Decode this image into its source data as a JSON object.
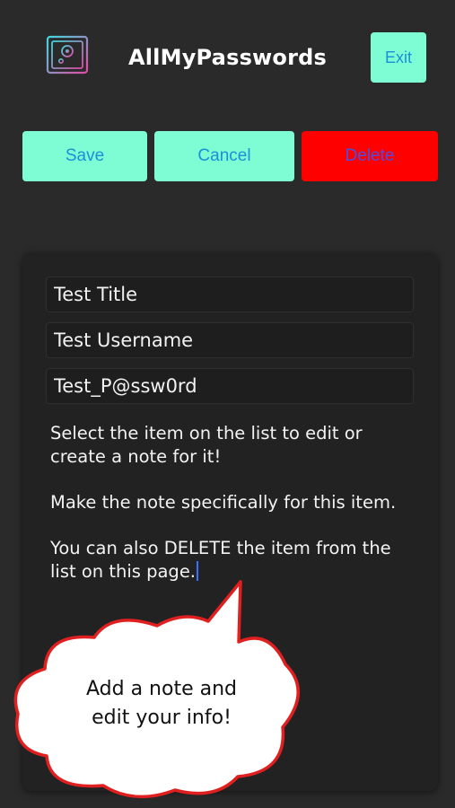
{
  "header": {
    "logo_icon": "safe-icon",
    "title": "AllMyPasswords",
    "exit_label": "Exit"
  },
  "toolbar": {
    "save_label": "Save",
    "cancel_label": "Cancel",
    "delete_label": "Delete"
  },
  "form": {
    "title_value": "Test Title",
    "username_value": "Test Username",
    "password_value": "Test_P@ssw0rd"
  },
  "note": {
    "paragraph1": "Select the item on the list to edit or create a note for it!",
    "paragraph2": "Make the note specifically for this item.",
    "paragraph3": "You can also DELETE the item from the list on this page."
  },
  "callout": {
    "line1": "Add a note and",
    "line2": "edit your info!"
  },
  "colors": {
    "accent": "#7efcd3",
    "button_text": "#1b8fd8",
    "danger": "#ff0000",
    "background": "#2a2a2b",
    "card": "#222223"
  }
}
